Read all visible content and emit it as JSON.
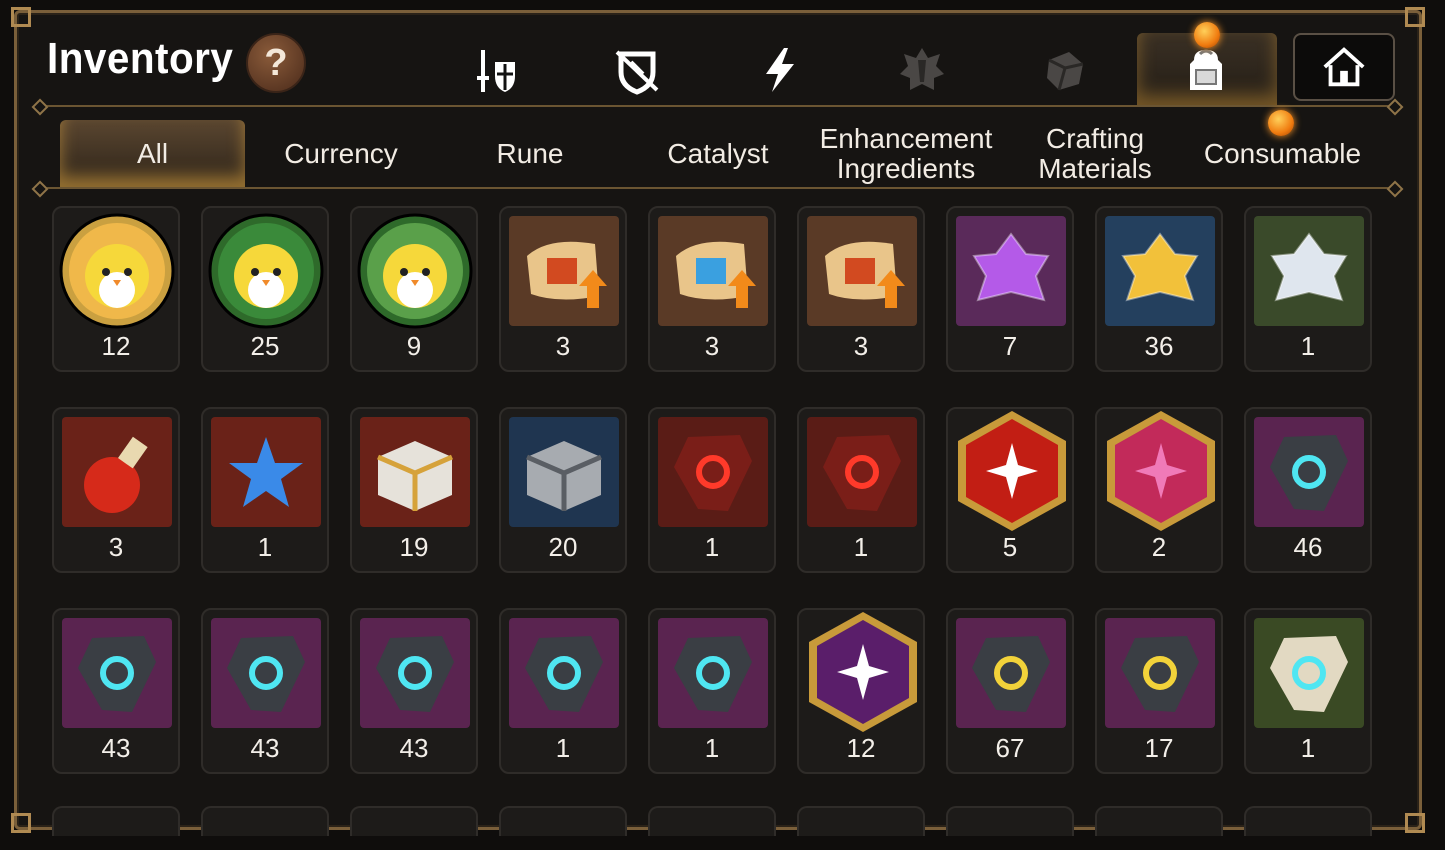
{
  "window": {
    "title": "Inventory",
    "help_label": "?"
  },
  "top_tabs": [
    {
      "icon": "sword-shield-icon"
    },
    {
      "icon": "broken-shield-icon"
    },
    {
      "icon": "lightning-icon"
    },
    {
      "icon": "crest-icon"
    },
    {
      "icon": "dice-icon"
    },
    {
      "icon": "backpack-icon",
      "active": true
    },
    {
      "icon": "house-icon"
    }
  ],
  "sub_tabs": [
    {
      "label": "All",
      "active": true
    },
    {
      "label": "Currency"
    },
    {
      "label": "Rune"
    },
    {
      "label": "Catalyst"
    },
    {
      "label": "Enhancement Ingredients"
    },
    {
      "label": "Crafting Materials"
    },
    {
      "label": "Consumable"
    }
  ],
  "items": [
    {
      "kind": "mascot-gold",
      "qty": "12"
    },
    {
      "kind": "mascot-green",
      "qty": "25"
    },
    {
      "kind": "mascot-leaf",
      "qty": "9"
    },
    {
      "kind": "scroll-dragon",
      "qty": "3"
    },
    {
      "kind": "scroll-rainbow",
      "qty": "3"
    },
    {
      "kind": "scroll-red",
      "qty": "3"
    },
    {
      "kind": "crystal-purple",
      "qty": "7"
    },
    {
      "kind": "crystal-gold",
      "qty": "36"
    },
    {
      "kind": "crystal-silver",
      "qty": "1"
    },
    {
      "kind": "potion-red",
      "qty": "3"
    },
    {
      "kind": "potion-star",
      "qty": "1"
    },
    {
      "kind": "chest-gold",
      "qty": "19"
    },
    {
      "kind": "chest-silver",
      "qty": "20"
    },
    {
      "kind": "stone-red-ring",
      "qty": "1"
    },
    {
      "kind": "stone-red-amulet",
      "qty": "1"
    },
    {
      "kind": "hex-red-star",
      "qty": "5"
    },
    {
      "kind": "hex-pink-potion",
      "qty": "2"
    },
    {
      "kind": "stone-purple-sword",
      "qty": "46"
    },
    {
      "kind": "stone-purple-helm",
      "qty": "43"
    },
    {
      "kind": "stone-purple-armor",
      "qty": "43"
    },
    {
      "kind": "stone-purple-boots",
      "qty": "43"
    },
    {
      "kind": "stone-purple-ring",
      "qty": "1"
    },
    {
      "kind": "stone-purple-amulet",
      "qty": "1"
    },
    {
      "kind": "hex-purple-star",
      "qty": "12"
    },
    {
      "kind": "stone-purple-hammer",
      "qty": "67"
    },
    {
      "kind": "stone-purple-exclaim",
      "qty": "17"
    },
    {
      "kind": "stone-green-sword",
      "qty": "1"
    }
  ],
  "colors": {
    "accent": "#f0a030",
    "frame": "#7a5f3a",
    "cell_bg": "#1d1b19"
  }
}
